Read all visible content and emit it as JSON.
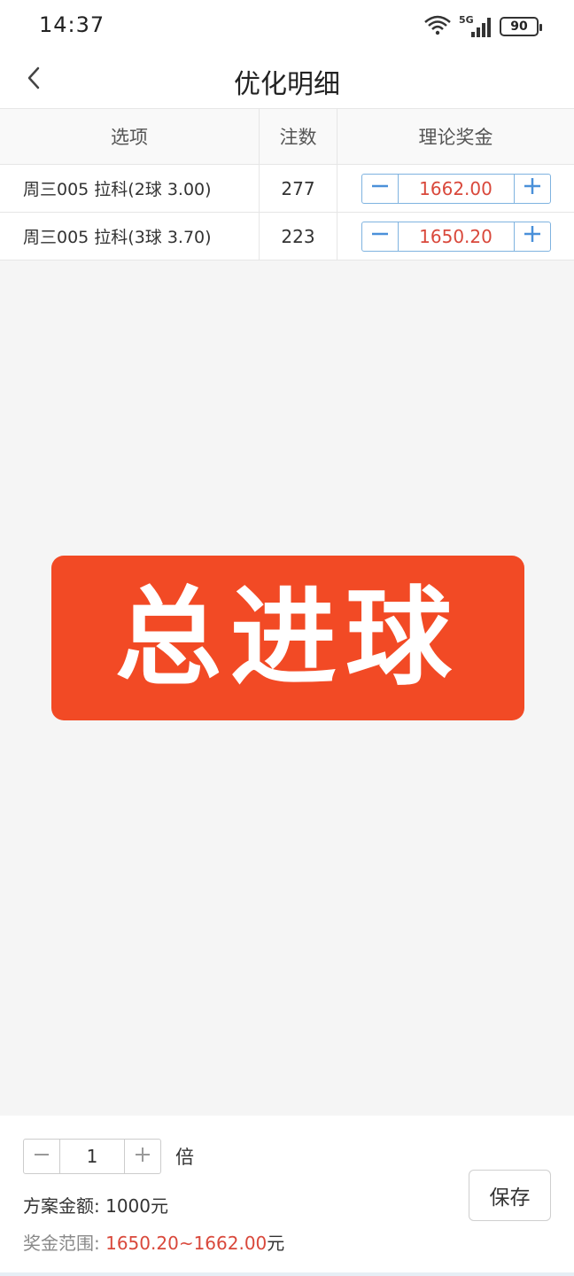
{
  "status_bar": {
    "time": "14:37",
    "network": "5G",
    "battery": "90"
  },
  "nav": {
    "title": "优化明细"
  },
  "table": {
    "headers": [
      "选项",
      "注数",
      "理论奖金"
    ],
    "rows": [
      {
        "option": "周三005 拉科(2球 3.00)",
        "count": "277",
        "prize": "1662.00"
      },
      {
        "option": "周三005 拉科(3球 3.70)",
        "count": "223",
        "prize": "1650.20"
      }
    ]
  },
  "banner": {
    "text": "总进球"
  },
  "footer": {
    "multiplier_value": "1",
    "multiplier_unit": "倍",
    "plan_amount": "方案金额: 1000元",
    "prize_range_label": "奖金范围:",
    "prize_range_value": "1650.20~1662.00",
    "prize_range_unit": "元",
    "save_label": "保存"
  },
  "colors": {
    "accent_red": "#d9483b",
    "banner_bg": "#f24a25",
    "stepper_border": "#7fb3e0"
  }
}
